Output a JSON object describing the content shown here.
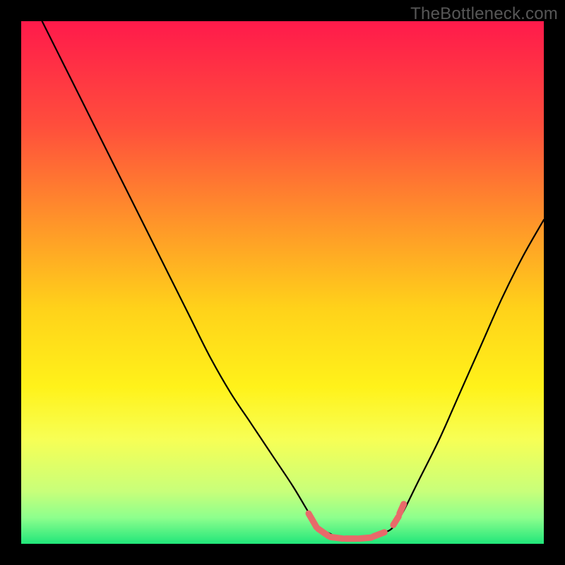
{
  "watermark": "TheBottleneck.com",
  "chart_data": {
    "type": "line",
    "title": "",
    "xlabel": "",
    "ylabel": "",
    "xlim": [
      0,
      100
    ],
    "ylim": [
      0,
      100
    ],
    "grid": false,
    "legend": false,
    "annotations": [],
    "background_gradient": {
      "stops": [
        {
          "offset": 0.0,
          "color": "#ff1a4b"
        },
        {
          "offset": 0.2,
          "color": "#ff4e3c"
        },
        {
          "offset": 0.4,
          "color": "#ff9a28"
        },
        {
          "offset": 0.55,
          "color": "#ffd21a"
        },
        {
          "offset": 0.7,
          "color": "#fff21a"
        },
        {
          "offset": 0.8,
          "color": "#f7ff55"
        },
        {
          "offset": 0.9,
          "color": "#c8ff7a"
        },
        {
          "offset": 0.95,
          "color": "#8dff8d"
        },
        {
          "offset": 1.0,
          "color": "#21e67a"
        }
      ]
    },
    "series": [
      {
        "name": "bottleneck-curve",
        "description": "Black V-shaped curve with a ragged valley floor",
        "stroke": "#000000",
        "x": [
          4,
          8,
          12,
          16,
          20,
          24,
          28,
          32,
          36,
          40,
          44,
          48,
          52,
          55,
          57,
          59,
          61,
          63,
          65,
          67,
          69,
          71,
          73,
          76,
          80,
          84,
          88,
          92,
          96,
          100
        ],
        "y": [
          100,
          92,
          84,
          76,
          68,
          60,
          52,
          44,
          36,
          29,
          23,
          17,
          11,
          6,
          3,
          2,
          1,
          1,
          1,
          1,
          2,
          3,
          6,
          12,
          20,
          29,
          38,
          47,
          55,
          62
        ]
      },
      {
        "name": "valley-segments",
        "description": "Short salmon dash segments near the valley bottom",
        "stroke": "#e86a6a",
        "segments": [
          {
            "x": [
              55.0,
              56.5
            ],
            "y": [
              5.8,
              3.2
            ]
          },
          {
            "x": [
              56.8,
              58.8
            ],
            "y": [
              2.9,
              1.5
            ]
          },
          {
            "x": [
              59.2,
              61.5
            ],
            "y": [
              1.3,
              1.0
            ]
          },
          {
            "x": [
              62.0,
              64.2
            ],
            "y": [
              1.0,
              1.0
            ]
          },
          {
            "x": [
              64.6,
              67.0
            ],
            "y": [
              1.0,
              1.2
            ]
          },
          {
            "x": [
              67.4,
              69.5
            ],
            "y": [
              1.4,
              2.2
            ]
          },
          {
            "x": [
              71.2,
              72.2
            ],
            "y": [
              3.6,
              5.2
            ]
          },
          {
            "x": [
              72.4,
              73.2
            ],
            "y": [
              5.8,
              7.6
            ]
          }
        ]
      }
    ]
  }
}
